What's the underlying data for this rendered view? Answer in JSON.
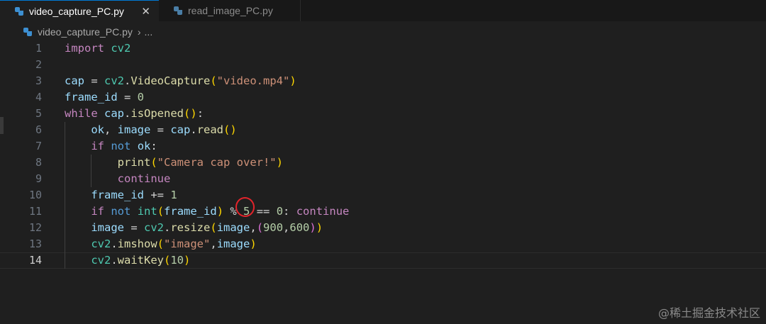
{
  "tabs": [
    {
      "label": "video_capture_PC.py",
      "active": true,
      "close": "✕"
    },
    {
      "label": "read_image_PC.py",
      "active": false
    }
  ],
  "breadcrumb": {
    "file": "video_capture_PC.py",
    "chevron": "›",
    "more": "..."
  },
  "current_line": 14,
  "lines": [
    {
      "n": "1",
      "tokens": [
        [
          "kw",
          "import"
        ],
        [
          "tx",
          " "
        ],
        [
          "mod",
          "cv2"
        ]
      ]
    },
    {
      "n": "2",
      "tokens": []
    },
    {
      "n": "3",
      "tokens": [
        [
          "var",
          "cap"
        ],
        [
          "op",
          " = "
        ],
        [
          "mod",
          "cv2"
        ],
        [
          "op",
          "."
        ],
        [
          "fn",
          "VideoCapture"
        ],
        [
          "pn",
          "("
        ],
        [
          "str",
          "\"video.mp4\""
        ],
        [
          "pn",
          ")"
        ]
      ]
    },
    {
      "n": "4",
      "tokens": [
        [
          "var",
          "frame_id"
        ],
        [
          "op",
          " = "
        ],
        [
          "num",
          "0"
        ]
      ]
    },
    {
      "n": "5",
      "tokens": [
        [
          "kw",
          "while"
        ],
        [
          "tx",
          " "
        ],
        [
          "var",
          "cap"
        ],
        [
          "op",
          "."
        ],
        [
          "fn",
          "isOpened"
        ],
        [
          "pn",
          "()"
        ],
        [
          "op",
          ":"
        ]
      ]
    },
    {
      "n": "6",
      "tokens": [
        [
          "tx",
          "    "
        ],
        [
          "var",
          "ok"
        ],
        [
          "op",
          ", "
        ],
        [
          "var",
          "image"
        ],
        [
          "op",
          " = "
        ],
        [
          "var",
          "cap"
        ],
        [
          "op",
          "."
        ],
        [
          "fn",
          "read"
        ],
        [
          "pn",
          "()"
        ]
      ]
    },
    {
      "n": "7",
      "tokens": [
        [
          "tx",
          "    "
        ],
        [
          "kw",
          "if"
        ],
        [
          "tx",
          " "
        ],
        [
          "kw2",
          "not"
        ],
        [
          "tx",
          " "
        ],
        [
          "var",
          "ok"
        ],
        [
          "op",
          ":"
        ]
      ]
    },
    {
      "n": "8",
      "tokens": [
        [
          "tx",
          "        "
        ],
        [
          "fn",
          "print"
        ],
        [
          "pn",
          "("
        ],
        [
          "str",
          "\"Camera cap over!\""
        ],
        [
          "pn",
          ")"
        ]
      ]
    },
    {
      "n": "9",
      "tokens": [
        [
          "tx",
          "        "
        ],
        [
          "kw",
          "continue"
        ]
      ]
    },
    {
      "n": "10",
      "tokens": [
        [
          "tx",
          "    "
        ],
        [
          "var",
          "frame_id"
        ],
        [
          "op",
          " += "
        ],
        [
          "num",
          "1"
        ]
      ]
    },
    {
      "n": "11",
      "tokens": [
        [
          "tx",
          "    "
        ],
        [
          "kw",
          "if"
        ],
        [
          "tx",
          " "
        ],
        [
          "kw2",
          "not"
        ],
        [
          "tx",
          " "
        ],
        [
          "bt",
          "int"
        ],
        [
          "pn",
          "("
        ],
        [
          "var",
          "frame_id"
        ],
        [
          "pn",
          ")"
        ],
        [
          "op",
          " % "
        ],
        [
          "num",
          "5"
        ],
        [
          "op",
          " == "
        ],
        [
          "num",
          "0"
        ],
        [
          "op",
          ": "
        ],
        [
          "kw",
          "continue"
        ]
      ]
    },
    {
      "n": "12",
      "tokens": [
        [
          "tx",
          "    "
        ],
        [
          "var",
          "image"
        ],
        [
          "op",
          " = "
        ],
        [
          "mod",
          "cv2"
        ],
        [
          "op",
          "."
        ],
        [
          "fn",
          "resize"
        ],
        [
          "pn",
          "("
        ],
        [
          "var",
          "image"
        ],
        [
          "op",
          ","
        ],
        [
          "pn2",
          "("
        ],
        [
          "num",
          "900"
        ],
        [
          "op",
          ","
        ],
        [
          "num",
          "600"
        ],
        [
          "pn2",
          ")"
        ],
        [
          "pn",
          ")"
        ]
      ]
    },
    {
      "n": "13",
      "tokens": [
        [
          "tx",
          "    "
        ],
        [
          "mod",
          "cv2"
        ],
        [
          "op",
          "."
        ],
        [
          "fn",
          "imshow"
        ],
        [
          "pn",
          "("
        ],
        [
          "str",
          "\"image\""
        ],
        [
          "op",
          ","
        ],
        [
          "var",
          "image"
        ],
        [
          "pn",
          ")"
        ]
      ]
    },
    {
      "n": "14",
      "tokens": [
        [
          "tx",
          "    "
        ],
        [
          "mod",
          "cv2"
        ],
        [
          "op",
          "."
        ],
        [
          "fn",
          "waitKey"
        ],
        [
          "pn",
          "("
        ],
        [
          "num",
          "10"
        ],
        [
          "pn",
          ")"
        ]
      ]
    }
  ],
  "watermark": "@稀土掘金技术社区",
  "colors": {
    "background": "#1f1f1f",
    "tab_accent": "#0078d4",
    "annotation": "#e3242b"
  }
}
